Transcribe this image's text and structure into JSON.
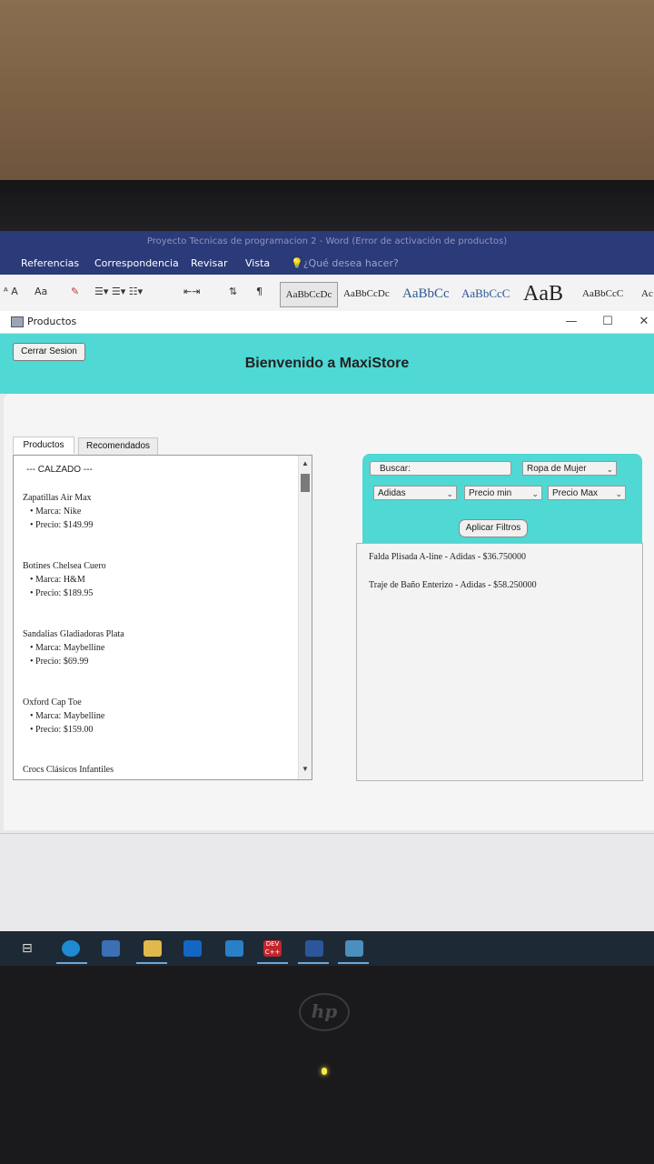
{
  "word": {
    "title": "Proyecto Tecnicas de programacion 2 - Word (Error de activación de productos)",
    "menu": [
      "Referencias",
      "Correspondencia",
      "Revisar",
      "Vista"
    ],
    "tell_me": "¿Qué desea hacer?",
    "style_samples": [
      "AaBbCcDc",
      "AaBbCcDc",
      "AaBbCc",
      "AaBbCcC",
      "AaB",
      "AaBbCcC",
      "Ac"
    ],
    "font_size_label": "Aa"
  },
  "window": {
    "title": "Productos",
    "minimize": "—",
    "maximize": "☐",
    "close": "✕"
  },
  "header": {
    "logout_label": "Cerrar Sesion",
    "welcome": "Bienvenido a MaxiStore"
  },
  "tabs": [
    "Productos",
    "Recomendados"
  ],
  "catalog": {
    "category": "--- CALZADO ---",
    "brand_prefix": "• Marca: ",
    "price_prefix": "• Precio: ",
    "products": [
      {
        "name": "Zapatillas Air Max",
        "marca": "• Marca: Nike",
        "precio": "• Precio: $149.99"
      },
      {
        "name": "Botines Chelsea Cuero",
        "marca": "• Marca: H&M",
        "precio": "• Precio: $189.95"
      },
      {
        "name": "Sandalias Gladiadoras Plata",
        "marca": "• Marca: Maybelline",
        "precio": "• Precio: $69.99"
      },
      {
        "name": "Oxford Cap Toe",
        "marca": "• Marca: Maybelline",
        "precio": "• Precio: $159.00"
      },
      {
        "name": "Crocs Clásicos Infantiles",
        "marca": "",
        "precio": ""
      }
    ]
  },
  "filters": {
    "search_label": "Buscar:",
    "category": "Ropa de Mujer",
    "brand": "Adidas",
    "price_min": "Precio min",
    "price_max": "Precio Max",
    "apply_label": "Aplicar Filtros"
  },
  "results": [
    "Falda Plisada A-line - Adidas - $36.750000",
    "Traje de Baño Enterizo - Adidas - $58.250000"
  ],
  "brand_logo": "hp"
}
